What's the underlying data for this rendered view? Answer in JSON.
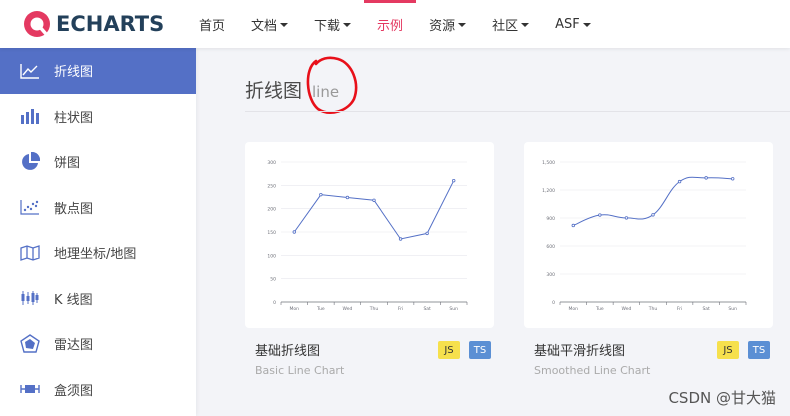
{
  "brand": {
    "name": "ECHARTS",
    "accent": "#e43961",
    "primary": "#5470c6"
  },
  "nav": {
    "items": [
      {
        "label": "首页",
        "dropdown": false,
        "active": false
      },
      {
        "label": "文档",
        "dropdown": true,
        "active": false
      },
      {
        "label": "下载",
        "dropdown": true,
        "active": false
      },
      {
        "label": "示例",
        "dropdown": false,
        "active": true
      },
      {
        "label": "资源",
        "dropdown": true,
        "active": false
      },
      {
        "label": "社区",
        "dropdown": true,
        "active": false
      },
      {
        "label": "ASF",
        "dropdown": true,
        "active": false
      }
    ]
  },
  "sidebar": {
    "items": [
      {
        "label": "折线图",
        "icon": "line-chart-icon",
        "active": true
      },
      {
        "label": "柱状图",
        "icon": "bar-chart-icon",
        "active": false
      },
      {
        "label": "饼图",
        "icon": "pie-chart-icon",
        "active": false
      },
      {
        "label": "散点图",
        "icon": "scatter-chart-icon",
        "active": false
      },
      {
        "label": "地理坐标/地图",
        "icon": "map-icon",
        "active": false
      },
      {
        "label": "K 线图",
        "icon": "candlestick-icon",
        "active": false
      },
      {
        "label": "雷达图",
        "icon": "radar-chart-icon",
        "active": false
      },
      {
        "label": "盒须图",
        "icon": "boxplot-icon",
        "active": false
      }
    ]
  },
  "section": {
    "title": "折线图",
    "subtitle": "line"
  },
  "cards": [
    {
      "title": "基础折线图",
      "subtitle": "Basic Line Chart",
      "badges": [
        "JS",
        "TS"
      ],
      "chart_data": {
        "type": "line",
        "categories": [
          "Mon",
          "Tue",
          "Wed",
          "Thu",
          "Fri",
          "Sat",
          "Sun"
        ],
        "values": [
          150,
          230,
          224,
          218,
          135,
          147,
          260
        ],
        "yticks": [
          "0",
          "50",
          "100",
          "150",
          "200",
          "250",
          "300"
        ],
        "ylim": [
          0,
          300
        ],
        "smooth": false
      }
    },
    {
      "title": "基础平滑折线图",
      "subtitle": "Smoothed Line Chart",
      "badges": [
        "JS",
        "TS"
      ],
      "chart_data": {
        "type": "line",
        "categories": [
          "Mon",
          "Tue",
          "Wed",
          "Thu",
          "Fri",
          "Sat",
          "Sun"
        ],
        "values": [
          820,
          932,
          901,
          934,
          1290,
          1330,
          1320
        ],
        "yticks": [
          "0",
          "300",
          "600",
          "900",
          "1,200",
          "1,500"
        ],
        "ylim": [
          0,
          1500
        ],
        "smooth": true
      }
    }
  ],
  "watermark": "CSDN @甘大猫"
}
